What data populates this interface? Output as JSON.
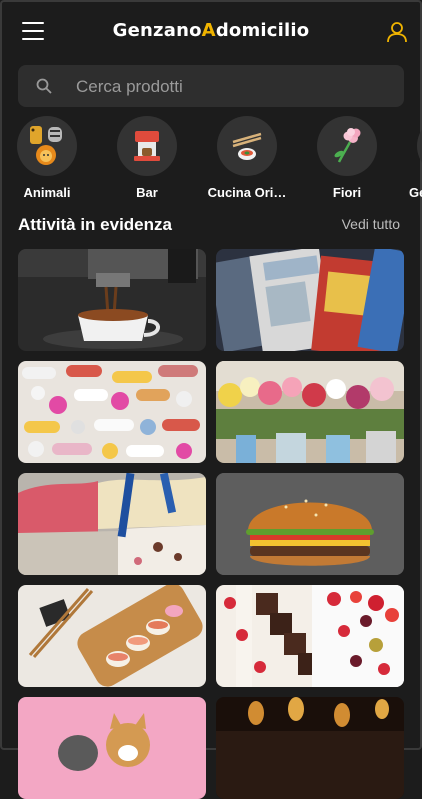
{
  "header": {
    "logo_part1": "Genzano",
    "logo_accent": "A",
    "logo_part2": "domicilio",
    "menu_icon": "hamburger-menu-icon",
    "user_icon": "user-icon"
  },
  "search": {
    "placeholder": "Cerca prodotti",
    "icon": "search-icon"
  },
  "categories": [
    {
      "label": "Animali",
      "icon": "animals-icon"
    },
    {
      "label": "Bar",
      "icon": "coffee-machine-icon"
    },
    {
      "label": "Cucina Ori…",
      "icon": "sushi-chopsticks-icon"
    },
    {
      "label": "Fiori",
      "icon": "flower-icon"
    },
    {
      "label": "Ge",
      "icon": "category-icon"
    }
  ],
  "featured": {
    "title": "Attività in evidenza",
    "see_all": "Vedi tutto",
    "tiles": [
      {
        "subject": "espresso-machine-photo"
      },
      {
        "subject": "comic-books-photo"
      },
      {
        "subject": "pills-photo"
      },
      {
        "subject": "flower-shop-photo"
      },
      {
        "subject": "gelato-photo"
      },
      {
        "subject": "burger-photo"
      },
      {
        "subject": "sushi-photo"
      },
      {
        "subject": "pastries-photo"
      },
      {
        "subject": "dogs-photo"
      },
      {
        "subject": "candles-photo"
      }
    ]
  },
  "colors": {
    "background": "#1c1c1c",
    "accent": "#f0b400",
    "surface": "#2e2e2e"
  }
}
